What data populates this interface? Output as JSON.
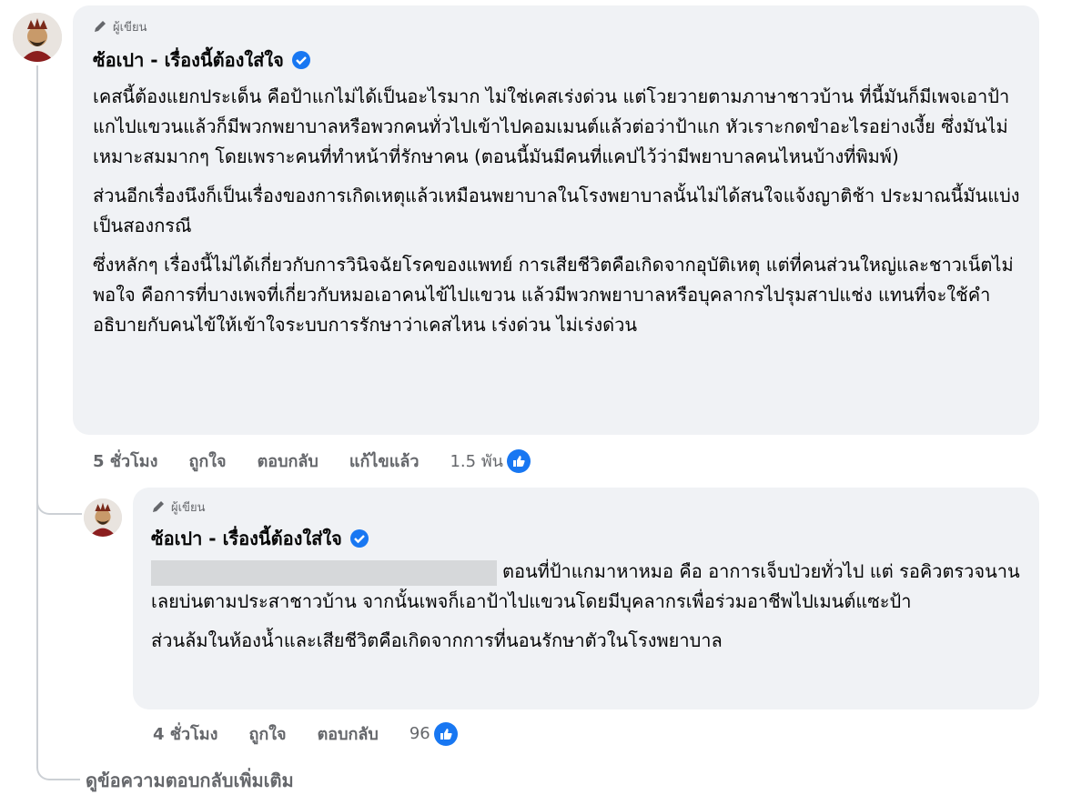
{
  "comment": {
    "badge": "ผู้เขียน",
    "author": "ซ้อเปา - เรื่องนี้ต้องใส่ใจ",
    "paragraphs": [
      "เคสนี้ต้องแยกประเด็น คือป้าแกไม่ได้เป็นอะไรมาก ไม่ใช่เคสเร่งด่วน แต่โวยวายตามภาษาชาวบ้าน ที่นี้มันก็มีเพจเอาป้าแกไปแขวนแล้วก็มีพวกพยาบาลหรือพวกคนทั่วไปเข้าไปคอมเมนต์แล้วต่อว่าป้าแก หัวเราะกดขำอะไรอย่างเงี้ย ซึ่งมันไม่เหมาะสมมากๆ โดยเพราะคนที่ทำหน้าที่รักษาคน (ตอนนี้มันมีคนที่แคปไว้ว่ามีพยาบาลคนไหนบ้างที่พิมพ์)",
      "ส่วนอีกเรื่องนึงก็เป็นเรื่องของการเกิดเหตุแล้วเหมือนพยาบาลในโรงพยาบาลนั้นไม่ได้สนใจแจ้งญาติช้า ประมาณนี้มันแบ่งเป็นสองกรณี",
      "ซึ่งหลักๆ เรื่องนี้ไม่ได้เกี่ยวกับการวินิจฉัยโรคของแพทย์ การเสียชีวิตคือเกิดจากอุบัติเหตุ แต่ที่คนส่วนใหญ่และชาวเน็ตไม่พอใจ คือการที่บางเพจที่เกี่ยวกับหมอเอาคนไข้ไปแขวน แล้วมีพวกพยาบาลหรือบุคลากรไปรุมสาปแช่ง แทนที่จะใช้คำอธิบายกับคนไข้ให้เข้าใจระบบการรักษาว่าเคสไหน เร่งด่วน ไม่เร่งด่วน"
    ],
    "time": "5 ชั่วโมง",
    "like_label": "ถูกใจ",
    "reply_label": "ตอบกลับ",
    "edited_label": "แก้ไขแล้ว",
    "reaction_count": "1.5 พัน"
  },
  "reply": {
    "badge": "ผู้เขียน",
    "author": "ซ้อเปา - เรื่องนี้ต้องใส่ใจ",
    "line1_text": "ตอนที่ป้าแกมาหาหมอ คือ อาการเจ็บป่วยทั่วไป แต่",
    "paragraph1_rest": "รอคิวตรวจนานเลยบ่นตามประสาชาวบ้าน จากนั้นเพจก็เอาป้าไปแขวนโดยมีบุคลากรเพื่อร่วมอาชีพไปเมนต์แซะป้า",
    "paragraph2": "ส่วนล้มในห้องน้ำและเสียชีวิตคือเกิดจากการที่นอนรักษาตัวในโรงพยาบาล",
    "time": "4 ชั่วโมง",
    "like_label": "ถูกใจ",
    "reply_label": "ตอบกลับ",
    "reaction_count": "96"
  },
  "more_replies": "ดูข้อความตอบกลับเพิ่มเติม",
  "colors": {
    "bubble": "#f0f2f5",
    "meta": "#65676b",
    "like": "#1877f2"
  }
}
